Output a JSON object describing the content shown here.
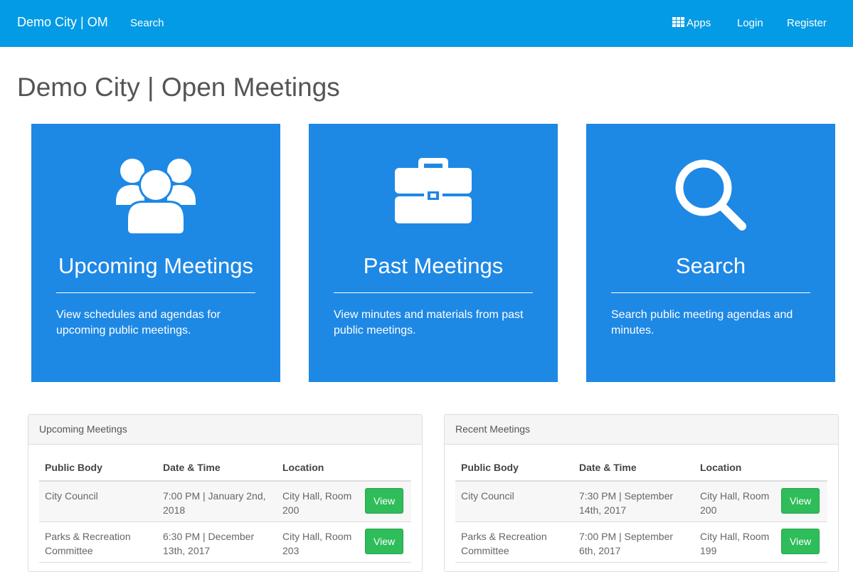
{
  "navbar": {
    "brand": "Demo City | OM",
    "search": "Search",
    "apps": "Apps",
    "login": "Login",
    "register": "Register"
  },
  "page": {
    "title": "Demo City | Open Meetings"
  },
  "tiles": [
    {
      "title": "Upcoming Meetings",
      "desc": "View schedules and agendas for upcoming public meetings.",
      "icon": "users-icon"
    },
    {
      "title": "Past Meetings",
      "desc": "View minutes and materials from past public meetings.",
      "icon": "briefcase-icon"
    },
    {
      "title": "Search",
      "desc": "Search public meeting agendas and minutes.",
      "icon": "search-icon"
    }
  ],
  "columns": {
    "body": "Public Body",
    "datetime": "Date & Time",
    "location": "Location"
  },
  "upcoming": {
    "heading": "Upcoming Meetings",
    "rows": [
      {
        "body": "City Council",
        "datetime": "7:00 PM | January 2nd, 2018",
        "location": "City Hall, Room 200",
        "action": "View"
      },
      {
        "body": "Parks & Recreation Committee",
        "datetime": "6:30 PM | December 13th, 2017",
        "location": "City Hall, Room 203",
        "action": "View"
      }
    ]
  },
  "recent": {
    "heading": "Recent Meetings",
    "rows": [
      {
        "body": "City Council",
        "datetime": "7:30 PM | September 14th, 2017",
        "location": "City Hall, Room 200",
        "action": "View"
      },
      {
        "body": "Parks & Recreation Committee",
        "datetime": "7:00 PM | September 6th, 2017",
        "location": "City Hall, Room 199",
        "action": "View"
      }
    ]
  },
  "colors": {
    "navbar": "#039be5",
    "tile": "#1e88e5",
    "button": "#2ebd59"
  }
}
